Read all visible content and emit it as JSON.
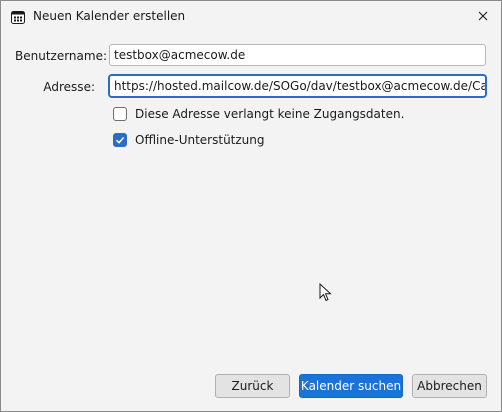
{
  "window": {
    "title": "Neuen Kalender erstellen",
    "app_icon": "calendar-icon",
    "close_icon": "close-icon"
  },
  "form": {
    "username_label": "Benutzername:",
    "username_value": "testbox@acmecow.de",
    "address_label": "Adresse:",
    "address_value": "https://hosted.mailcow.de/SOGo/dav/testbox@acmecow.de/Calendar/personal/"
  },
  "options": {
    "no_credentials_label": "Diese Adresse verlangt keine Zugangsdaten.",
    "no_credentials_checked": false,
    "offline_label": "Offline-Unterstützung",
    "offline_checked": true
  },
  "buttons": {
    "back_label": "Zurück",
    "search_label": "Kalender suchen",
    "cancel_label": "Abbrechen"
  },
  "colors": {
    "accent": "#1a73d9",
    "checkbox_checked": "#2a6cc6",
    "background": "#f3f3f3"
  }
}
